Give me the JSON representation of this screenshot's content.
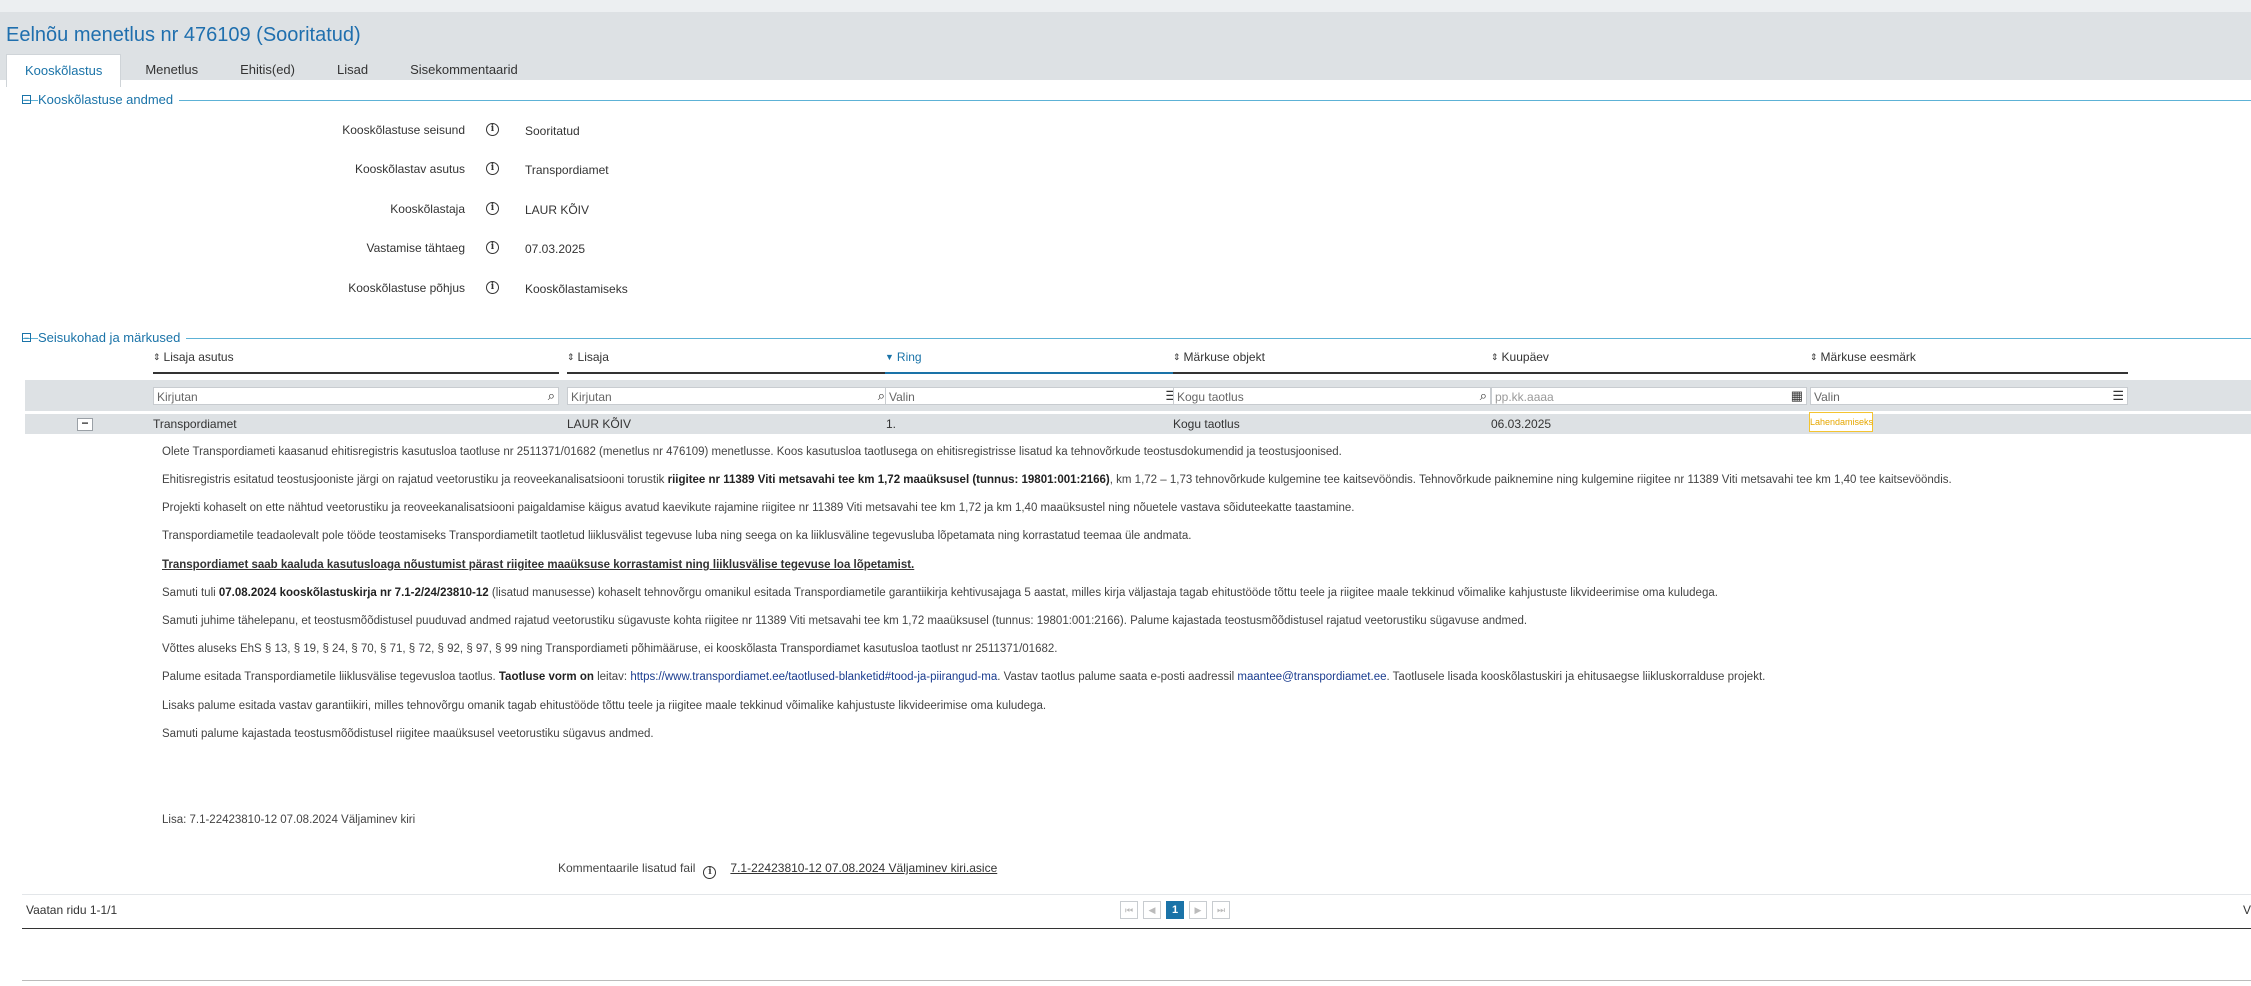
{
  "page": {
    "title": "Eelnõu menetlus nr 476109 (Sooritatud)"
  },
  "tabs": [
    {
      "label": "Kooskõlastus",
      "active": true
    },
    {
      "label": "Menetlus"
    },
    {
      "label": "Ehitis(ed)"
    },
    {
      "label": "Lisad"
    },
    {
      "label": "Sisekommentaarid"
    }
  ],
  "section1": {
    "title": "Kooskõlastuse andmed",
    "fields": [
      {
        "label": "Kooskõlastuse seisund",
        "value": "Sooritatud"
      },
      {
        "label": "Kooskõlastav asutus",
        "value": "Transpordiamet"
      },
      {
        "label": "Kooskõlastaja",
        "value": "LAUR KÕIV"
      },
      {
        "label": "Vastamise tähtaeg",
        "value": "07.03.2025"
      },
      {
        "label": "Kooskõlastuse põhjus",
        "value": "Kooskõlastamiseks"
      }
    ]
  },
  "section2": {
    "title": "Seisukohad ja märkused",
    "columns": [
      "Lisaja asutus",
      "Lisaja",
      "Ring",
      "Märkuse objekt",
      "Kuupäev",
      "Märkuse eesmärk"
    ],
    "filters": [
      "Kirjutan",
      "Kirjutan",
      "Valin",
      "Kogu taotlus",
      "pp.kk.aaaa",
      "Valin"
    ],
    "row": {
      "asutus": "Transpordiamet",
      "lisaja": "LAUR KÕIV",
      "ring": "1.",
      "objekt": "Kogu taotlus",
      "kuupaev": "06.03.2025",
      "eesmark": "Lahendamiseks"
    },
    "comment": {
      "p1": "Olete Transpordiameti kaasanud ehitisregistris kasutusloa taotluse nr 2511371/01682 (menetlus nr 476109) menetlusse. Koos kasutusloa taotlusega on ehitisregistrisse lisatud ka tehnovõrkude teostusdokumendid ja teostusjoonised.",
      "p2a": "Ehitisregistris esitatud teostusjooniste järgi on rajatud veetorustiku ja reoveekanalisatsiooni torustik ",
      "p2b": "riigitee nr 11389 Viti metsavahi tee km 1,72 maaüksusel (tunnus: 19801:001:2166)",
      "p2c": ", km 1,72 – 1,73 tehnovõrkude kulgemine tee kaitsevööndis. Tehnovõrkude paiknemine ning kulgemine riigitee nr 11389 Viti metsavahi tee km 1,40 tee kaitsevööndis.",
      "p3": "Projekti kohaselt on ette nähtud veetorustiku ja reoveekanalisatsiooni paigaldamise käigus avatud kaevikute rajamine riigitee nr 11389 Viti metsavahi tee km 1,72 ja km 1,40 maaüksustel ning nõuetele vastava sõiduteekatte taastamine.",
      "p4": "Transpordiametile teadaolevalt pole tööde teostamiseks Transpordiametilt taotletud liiklusvälist tegevuse luba ning seega on ka liiklusväline tegevusluba lõpetamata ning korrastatud teemaa üle andmata.",
      "p5": "Transpordiamet saab kaaluda kasutusloaga nõustumist pärast riigitee maaüksuse korrastamist ning liiklusvälise tegevuse loa lõpetamist.",
      "p6a": "Samuti tuli ",
      "p6b": "07.08.2024 kooskõlastuskirja nr 7.1-2/24/23810-12",
      "p6c": " (lisatud manusesse) kohaselt tehnovõrgu omanikul esitada Transpordiametile garantiikirja kehtivusajaga 5 aastat, milles kirja väljastaja tagab ehitustööde tõttu teele ja riigitee maale tekkinud võimalike kahjustuste likvideerimise oma kuludega.",
      "p7": "Samuti juhime tähelepanu, et teostusmõõdistusel puuduvad andmed rajatud veetorustiku sügavuste kohta riigitee nr 11389 Viti metsavahi tee km 1,72 maaüksusel (tunnus: 19801:001:2166). Palume kajastada teostusmõõdistusel rajatud veetorustiku sügavuse andmed.",
      "p8": "Võttes aluseks EhS § 13, § 19, § 24, § 70, § 71, § 72, § 92, § 97, § 99 ning Transpordiameti põhimääruse, ei kooskõlasta Transpordiamet kasutusloa taotlust nr 2511371/01682.",
      "p9a": "Palume esitada Transpordiametile liiklusvälise tegevusloa taotlus. ",
      "p9b": "Taotluse vorm on",
      "p9c": " leitav: ",
      "p9d": "https://www.transpordiamet.ee/taotlused-blanketid#tood-ja-piirangud-ma",
      "p9e": ". Vastav taotlus palume saata e-posti aadressil ",
      "p9f": "maantee@transpordiamet.ee",
      "p9g": ". Taotlusele lisada kooskõlastuskiri ja ehitusaegse liikluskorralduse projekt.",
      "p10": "Lisaks palume esitada vastav garantiikiri, milles tehnovõrgu omanik tagab ehitustööde tõttu teele ja riigitee maale tekkinud võimalike kahjustuste likvideerimise oma kuludega.",
      "p11": "Samuti palume kajastada teostusmõõdistusel riigitee maaüksusel veetorustiku sügavus andmed.",
      "p12": "Lisa: 7.1-22423810-12 07.08.2024 Väljaminev kiri"
    },
    "attachment": {
      "label": "Kommentaarile lisatud fail",
      "file": "7.1-22423810-12 07.08.2024 Väljaminev kiri.asice"
    }
  },
  "footer": {
    "rowcount": "Vaatan ridu 1-1/1",
    "page": "1",
    "right_fragment": "V"
  },
  "colors": {
    "accent": "#1a73a8",
    "badge": "#f4c430"
  },
  "icons": {
    "search": "search-icon",
    "list": "list-icon",
    "calendar": "calendar-icon",
    "info": "info-icon"
  }
}
